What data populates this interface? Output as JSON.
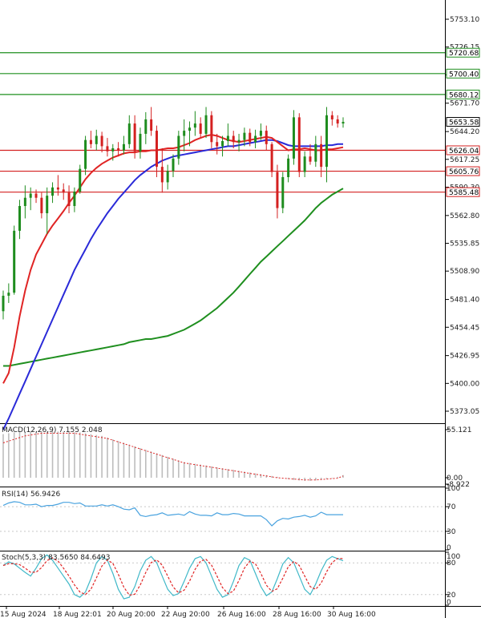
{
  "colors": {
    "background": "#ffffff",
    "up_candle": "#1e8c1e",
    "down_candle": "#d42020",
    "ma_fast": "#e02424",
    "ma_mid": "#2a2ad8",
    "ma_slow": "#1f8f1f",
    "resistance": "#1f8f1f",
    "support": "#d42020",
    "macd_hist": "#bdbdbd",
    "macd_signal": "#e02424",
    "rsi": "#4aa3df",
    "stoch_k": "#3fb8c8",
    "stoch_d": "#e02424"
  },
  "chart_data": [
    {
      "type": "candlestick",
      "price_axis_ticks": [
        "5753.10",
        "5726.15",
        "5699.20",
        "5671.70",
        "5644.20",
        "5617.25",
        "5590.30",
        "5562.80",
        "5535.85",
        "5508.90",
        "5481.40",
        "5454.45",
        "5426.95",
        "5400.00",
        "5373.05"
      ],
      "time_axis_labels": [
        "15 Aug 2024",
        "18 Aug 22:01",
        "20 Aug 20:00",
        "22 Aug 20:00",
        "26 Aug 16:00",
        "28 Aug 16:00",
        "30 Aug 16:00"
      ],
      "current_price": "5653.58",
      "ylim": [
        5360,
        5765
      ],
      "resistance_levels": [
        {
          "label": "5720.68",
          "value": 5720.68
        },
        {
          "label": "5700.40",
          "value": 5700.4
        },
        {
          "label": "5680.12",
          "value": 5680.12
        }
      ],
      "support_levels": [
        {
          "label": "5626.04",
          "value": 5626.04
        },
        {
          "label": "5605.76",
          "value": 5605.76
        },
        {
          "label": "5585.48",
          "value": 5585.48
        }
      ],
      "candles": [
        [
          5470,
          5490,
          5462,
          5485
        ],
        [
          5485,
          5497,
          5478,
          5488
        ],
        [
          5488,
          5553,
          5486,
          5548
        ],
        [
          5548,
          5578,
          5540,
          5572
        ],
        [
          5572,
          5592,
          5560,
          5580
        ],
        [
          5580,
          5590,
          5568,
          5584
        ],
        [
          5584,
          5588,
          5575,
          5580
        ],
        [
          5580,
          5585,
          5560,
          5565
        ],
        [
          5565,
          5590,
          5545,
          5582
        ],
        [
          5582,
          5595,
          5575,
          5590
        ],
        [
          5590,
          5602,
          5582,
          5588
        ],
        [
          5588,
          5594,
          5578,
          5585
        ],
        [
          5585,
          5592,
          5565,
          5572
        ],
        [
          5572,
          5590,
          5566,
          5586
        ],
        [
          5586,
          5612,
          5584,
          5608
        ],
        [
          5608,
          5640,
          5602,
          5636
        ],
        [
          5636,
          5645,
          5628,
          5632
        ],
        [
          5632,
          5646,
          5626,
          5640
        ],
        [
          5640,
          5644,
          5624,
          5630
        ],
        [
          5630,
          5638,
          5620,
          5625
        ],
        [
          5625,
          5632,
          5616,
          5628
        ],
        [
          5628,
          5634,
          5620,
          5626
        ],
        [
          5626,
          5640,
          5622,
          5632
        ],
        [
          5632,
          5660,
          5628,
          5652
        ],
        [
          5652,
          5660,
          5618,
          5625
        ],
        [
          5625,
          5648,
          5618,
          5642
        ],
        [
          5642,
          5663,
          5632,
          5656
        ],
        [
          5656,
          5668,
          5640,
          5645
        ],
        [
          5645,
          5650,
          5600,
          5610
        ],
        [
          5610,
          5628,
          5585,
          5595
        ],
        [
          5595,
          5612,
          5588,
          5606
        ],
        [
          5606,
          5622,
          5600,
          5618
        ],
        [
          5618,
          5645,
          5612,
          5640
        ],
        [
          5640,
          5656,
          5625,
          5645
        ],
        [
          5645,
          5654,
          5630,
          5648
        ],
        [
          5648,
          5664,
          5640,
          5652
        ],
        [
          5652,
          5658,
          5638,
          5642
        ],
        [
          5642,
          5668,
          5638,
          5660
        ],
        [
          5660,
          5664,
          5628,
          5634
        ],
        [
          5634,
          5642,
          5622,
          5630
        ],
        [
          5630,
          5640,
          5620,
          5635
        ],
        [
          5635,
          5652,
          5630,
          5640
        ],
        [
          5640,
          5645,
          5628,
          5634
        ],
        [
          5634,
          5642,
          5625,
          5636
        ],
        [
          5636,
          5648,
          5630,
          5643
        ],
        [
          5643,
          5647,
          5630,
          5634
        ],
        [
          5634,
          5646,
          5628,
          5640
        ],
        [
          5640,
          5652,
          5636,
          5645
        ],
        [
          5645,
          5650,
          5626,
          5632
        ],
        [
          5632,
          5634,
          5600,
          5605
        ],
        [
          5605,
          5612,
          5560,
          5570
        ],
        [
          5570,
          5605,
          5565,
          5600
        ],
        [
          5600,
          5622,
          5595,
          5618
        ],
        [
          5618,
          5665,
          5612,
          5658
        ],
        [
          5658,
          5662,
          5600,
          5605
        ],
        [
          5605,
          5625,
          5600,
          5620
        ],
        [
          5620,
          5632,
          5612,
          5615
        ],
        [
          5615,
          5640,
          5610,
          5632
        ],
        [
          5632,
          5640,
          5600,
          5610
        ],
        [
          5610,
          5668,
          5595,
          5660
        ],
        [
          5660,
          5664,
          5650,
          5656
        ],
        [
          5656,
          5660,
          5648,
          5652
        ],
        [
          5652,
          5658,
          5648,
          5653.58
        ]
      ],
      "ma_fast": [
        5400,
        5410,
        5435,
        5465,
        5490,
        5510,
        5525,
        5535,
        5545,
        5553,
        5560,
        5567,
        5575,
        5582,
        5590,
        5598,
        5604,
        5609,
        5613,
        5616,
        5619,
        5621,
        5623,
        5624,
        5624,
        5625,
        5625,
        5626,
        5626,
        5627,
        5628,
        5628,
        5629,
        5631,
        5633,
        5636,
        5638,
        5640,
        5641,
        5640,
        5638,
        5636,
        5635,
        5634,
        5635,
        5636,
        5637,
        5638,
        5639,
        5638,
        5634,
        5630,
        5626,
        5627,
        5627,
        5628,
        5627,
        5626,
        5626,
        5627,
        5627,
        5628,
        5629
      ],
      "ma_mid": [
        5355,
        5366,
        5378,
        5390,
        5402,
        5414,
        5426,
        5438,
        5450,
        5462,
        5474,
        5486,
        5498,
        5510,
        5520,
        5530,
        5540,
        5549,
        5557,
        5565,
        5572,
        5579,
        5585,
        5591,
        5597,
        5602,
        5606,
        5610,
        5613,
        5616,
        5618,
        5620,
        5621,
        5622,
        5623,
        5624,
        5625,
        5626,
        5627,
        5628,
        5629,
        5630,
        5630,
        5631,
        5632,
        5633,
        5634,
        5635,
        5636,
        5636,
        5635,
        5633,
        5631,
        5630,
        5630,
        5630,
        5630,
        5630,
        5630,
        5631,
        5631,
        5632,
        5632
      ],
      "ma_slow": [
        5417,
        5417,
        5418,
        5419,
        5420,
        5421,
        5422,
        5423,
        5424,
        5425,
        5426,
        5427,
        5428,
        5429,
        5430,
        5431,
        5432,
        5433,
        5434,
        5435,
        5436,
        5437,
        5438,
        5440,
        5441,
        5442,
        5443,
        5443,
        5444,
        5445,
        5446,
        5448,
        5450,
        5452,
        5455,
        5458,
        5461,
        5465,
        5469,
        5473,
        5478,
        5483,
        5488,
        5494,
        5500,
        5506,
        5512,
        5518,
        5523,
        5528,
        5533,
        5538,
        5543,
        5548,
        5553,
        5558,
        5564,
        5570,
        5575,
        5579,
        5583,
        5586,
        5589
      ]
    },
    {
      "type": "bar",
      "label": "MACD(12,26,9) 7.155 2.048",
      "axis_ticks": [
        "55.121",
        "0.00",
        "-8.922"
      ],
      "ylim": [
        -8.922,
        55.121
      ],
      "histogram": [
        50,
        51,
        52,
        53,
        53,
        53,
        53,
        53,
        53,
        53,
        53,
        53,
        53,
        52,
        52,
        51,
        50,
        49,
        48,
        46,
        44,
        42,
        40,
        38,
        36,
        34,
        32,
        30,
        28,
        26,
        24,
        22,
        20,
        18,
        17,
        16,
        15,
        14,
        13,
        12,
        11,
        10,
        9,
        8,
        7,
        6,
        5,
        4,
        3,
        2,
        1,
        -1,
        -3,
        -5,
        -6,
        -7,
        -7,
        -6,
        -5,
        -3,
        -1,
        1,
        3
      ],
      "signal": [
        40,
        42,
        44,
        46,
        48,
        49,
        50,
        51,
        51,
        51,
        51,
        51,
        51,
        51,
        50,
        49,
        48,
        47,
        46,
        45,
        43,
        41,
        39,
        37,
        35,
        33,
        31,
        29,
        27,
        25,
        23,
        21,
        19,
        17,
        16,
        15,
        14,
        13,
        12,
        11,
        10,
        9,
        8,
        7,
        6,
        5,
        4,
        3,
        2,
        1,
        0,
        -1,
        -2,
        -3,
        -4,
        -5,
        -5,
        -5,
        -4,
        -3,
        -2,
        -1,
        2
      ]
    },
    {
      "type": "line",
      "label": "RSI(14) 56.9426",
      "axis_ticks": [
        "100",
        "70",
        "30",
        "0"
      ],
      "ylim": [
        0,
        100
      ],
      "values": [
        72,
        76,
        78,
        77,
        73,
        73,
        74,
        70,
        72,
        72,
        74,
        77,
        77,
        75,
        76,
        71,
        71,
        71,
        73,
        71,
        73,
        70,
        66,
        65,
        68,
        56,
        54,
        56,
        57,
        60,
        56,
        57,
        58,
        56,
        62,
        58,
        56,
        56,
        55,
        60,
        57,
        57,
        59,
        58,
        55,
        55,
        55,
        55,
        49,
        39,
        47,
        51,
        50,
        53,
        54,
        56,
        53,
        55,
        61,
        57,
        57,
        57,
        57
      ]
    },
    {
      "type": "line",
      "label": "Stoch(5,3,3) 83.5650 84.6493",
      "axis_ticks": [
        "100",
        "80",
        "20",
        "0"
      ],
      "ylim": [
        0,
        100
      ],
      "k": [
        75,
        82,
        78,
        70,
        62,
        55,
        70,
        88,
        95,
        85,
        70,
        55,
        40,
        20,
        15,
        25,
        50,
        80,
        92,
        85,
        60,
        30,
        12,
        15,
        35,
        65,
        85,
        92,
        80,
        55,
        30,
        18,
        22,
        45,
        70,
        88,
        92,
        80,
        55,
        30,
        15,
        20,
        45,
        75,
        90,
        85,
        60,
        35,
        18,
        25,
        50,
        78,
        90,
        80,
        55,
        30,
        20,
        40,
        65,
        85,
        92,
        88,
        84
      ]
    }
  ]
}
